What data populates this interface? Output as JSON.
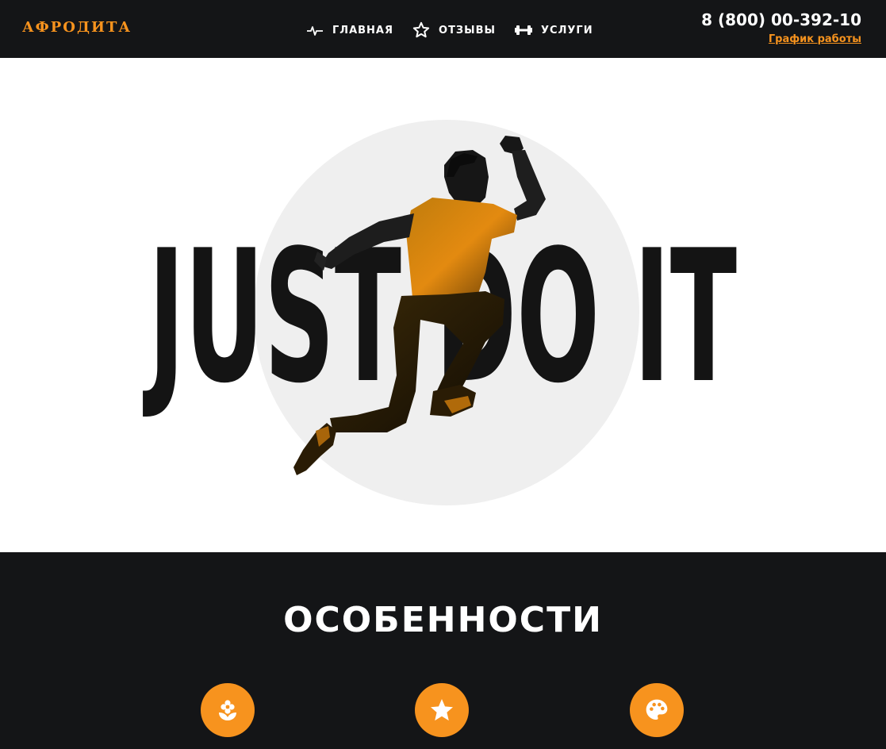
{
  "header": {
    "logo": "АФРОДИТА",
    "nav": [
      {
        "label": "ГЛАВНАЯ",
        "icon": "pulse-icon"
      },
      {
        "label": "ОТЗЫВЫ",
        "icon": "star-outline-icon"
      },
      {
        "label": "УСЛУГИ",
        "icon": "dumbbell-icon"
      }
    ],
    "phone": "8 (800) 00-392-10",
    "schedule_link": "График работы"
  },
  "hero": {
    "slogan": "JUST DO IT",
    "image": "jumping-athlete-silhouette"
  },
  "features": {
    "title": "ОСОБЕННОСТИ",
    "items": [
      {
        "icon": "flower-icon"
      },
      {
        "icon": "star-icon"
      },
      {
        "icon": "palette-icon"
      }
    ]
  },
  "colors": {
    "accent": "#f7931e",
    "dark": "#141517",
    "hero_circle": "#efefef",
    "slogan": "#141414"
  }
}
